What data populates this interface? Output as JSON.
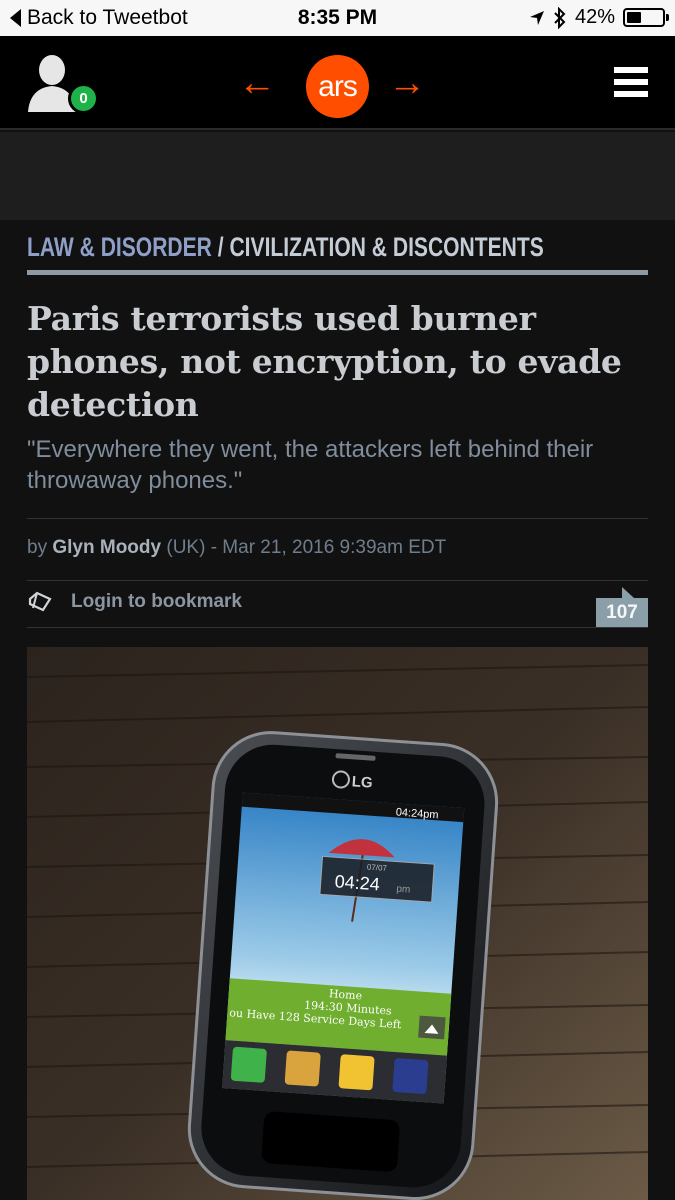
{
  "status_bar": {
    "back_label": "Back to Tweetbot",
    "time": "8:35 PM",
    "battery_text": "42%",
    "battery_level": 0.42
  },
  "header": {
    "logo_text": "ars",
    "notification_count": "0",
    "prev_arrow": "←",
    "next_arrow": "→",
    "accent_color": "#ff4e00"
  },
  "article": {
    "section": "Law & Disorder",
    "separator": "/",
    "subsection": "Civilization & Discontents",
    "title": "Paris terrorists used burner phones, not encryption, to evade detection",
    "subtitle": "\"Everywhere they went, the attackers left behind their throwaway phones.\"",
    "byline_prefix": "by",
    "author": "Glyn Moody",
    "byline_suffix": "(UK) - Mar 21, 2016 9:39am EDT",
    "bookmark_label": "Login to bookmark",
    "comment_count": "107"
  },
  "photo": {
    "brand": "LG",
    "status_time": "04:24pm",
    "widget_time": "04:24",
    "widget_ampm": "pm",
    "widget_date": "07/07",
    "line1": "Home",
    "line2": "194:30 Minutes",
    "line3": "ou Have 128 Service Days Left"
  }
}
